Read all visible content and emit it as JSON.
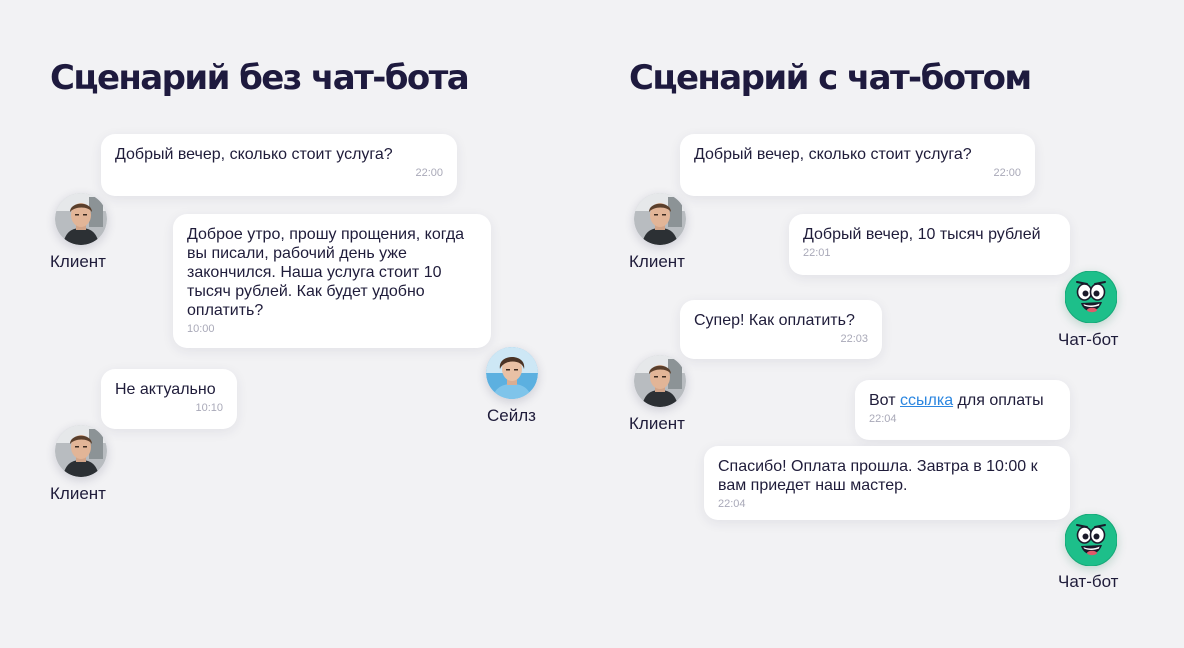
{
  "left": {
    "title": "Сценарий без чат-бота",
    "messages": [
      {
        "text": "Добрый вечер, сколько стоит услуга?",
        "time": "22:00"
      },
      {
        "text": "Доброе утро, прошу прощения, когда вы писали, рабочий день уже закончился. Наша услуга стоит 10 тысяч рублей. Как будет удобно оплатить?",
        "time": "10:00"
      },
      {
        "text": "Не актуально",
        "time": "10:10"
      }
    ],
    "labels": {
      "client": "Клиент",
      "sales": "Сейлз"
    }
  },
  "right": {
    "title": "Сценарий с чат-ботом",
    "messages": [
      {
        "text": "Добрый вечер, сколько стоит услуга?",
        "time": "22:00"
      },
      {
        "text": "Добрый вечер, 10 тысяч рублей",
        "time": "22:01"
      },
      {
        "text": "Супер! Как оплатить?",
        "time": "22:03"
      },
      {
        "text_before": "Вот ",
        "link": "ссылка",
        "text_after": " для оплаты",
        "time": "22:04"
      },
      {
        "text": "Спасибо! Оплата прошла. Завтра в 10:00 к вам приедет наш мастер.",
        "time": "22:04"
      }
    ],
    "labels": {
      "client": "Клиент",
      "bot": "Чат-бот"
    }
  },
  "colors": {
    "title": "#1e1a3e",
    "bot": "#1dbf8a",
    "link": "#2b86e0",
    "background": "#f2f2f4"
  },
  "icons": {
    "client_avatar": "person-photo-avatar",
    "sales_avatar": "person-photo-avatar",
    "bot_avatar": "smiley-bot-icon"
  }
}
